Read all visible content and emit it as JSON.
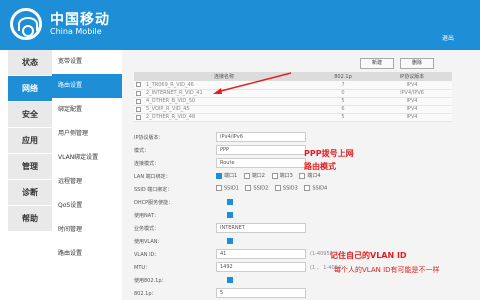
{
  "brand": {
    "name_cn": "中国移动",
    "name_en": "China Mobile"
  },
  "header": {
    "exit": "退出"
  },
  "nav": [
    {
      "label": "状态",
      "active": false
    },
    {
      "label": "网络",
      "active": true
    },
    {
      "label": "安全",
      "active": false
    },
    {
      "label": "应用",
      "active": false
    },
    {
      "label": "管理",
      "active": false
    },
    {
      "label": "诊断",
      "active": false
    },
    {
      "label": "帮助",
      "active": false
    }
  ],
  "subnav": [
    "宽带设置",
    "路由设置",
    "绑定配置",
    "用户侧管理",
    "VLAN绑定设置",
    "远程管理",
    "QoS设置",
    "时间管理",
    "路由设置"
  ],
  "buttons": {
    "new": "新建",
    "delete": "删除"
  },
  "table": {
    "headers": [
      "连接名称",
      "802.1p",
      "IP协议版本"
    ],
    "rows": [
      [
        "1_TR069_R_VID_46",
        "7",
        "IPV4"
      ],
      [
        "2_INTERNET_R_VID_41",
        "0",
        "IPV4/IPV6"
      ],
      [
        "4_OTHER_B_VID_50",
        "5",
        "IPV4"
      ],
      [
        "5_VOIP_R_VID_45",
        "6",
        "IPV4"
      ],
      [
        "2_OTHER_R_VID_48",
        "5",
        "IPV4"
      ]
    ]
  },
  "form": {
    "ip_version": {
      "label": "IP协议版本：",
      "value": "IPv4/IPv6"
    },
    "mode": {
      "label": "模式：",
      "value": "PPP"
    },
    "conn_mode": {
      "label": "连接模式：",
      "value": "Route"
    },
    "lan_bind": {
      "label": "LAN 端口绑定：",
      "options": [
        "端口1",
        "端口2",
        "端口3",
        "端口4"
      ]
    },
    "ssid_bind": {
      "label": "SSID 端口绑定：",
      "options": [
        "SSID1",
        "SSID2",
        "SSID3",
        "SSID4"
      ]
    },
    "dhcp": {
      "label": "DHCP服务使能："
    },
    "nat": {
      "label": "使用NAT："
    },
    "service_mode": {
      "label": "业务模式：",
      "value": "INTERNET"
    },
    "vlan_enable": {
      "label": "使用VLAN："
    },
    "vlan_id": {
      "label": "VLAN ID：",
      "value": "41",
      "hint": "(1-4095)"
    },
    "mtu": {
      "label": "MTU：",
      "value": "1492",
      "hint": "(1 、 1-4094)"
    },
    "enable_8021p": {
      "label": "使用802.1p："
    },
    "p8021": {
      "label": "802.1p：",
      "value": "5"
    }
  },
  "annotations": {
    "ppp": "PPP拨号上网",
    "route": "路由模式",
    "vlan": "记住自己的VLAN ID",
    "vlan_note": "每个人的VLAN ID有可能是不一样"
  },
  "colors": {
    "primary": "#1e8ed6",
    "annotation": "#e02020"
  }
}
